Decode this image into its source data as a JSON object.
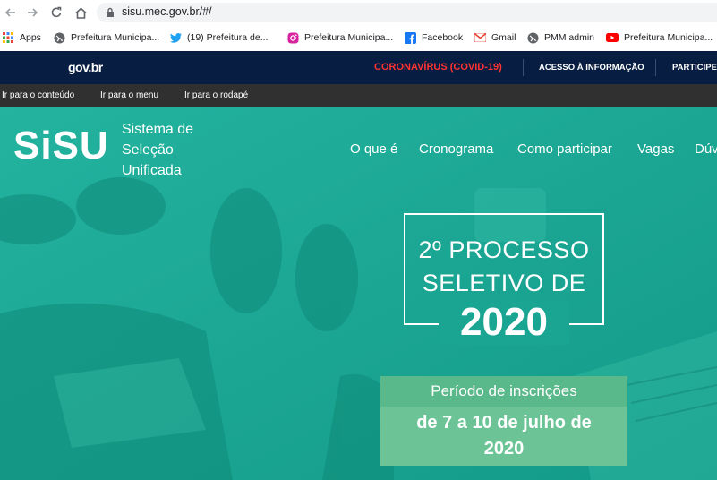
{
  "browser": {
    "url": "sisu.mec.gov.br/#/"
  },
  "bookmarks": [
    {
      "label": "Apps",
      "icon": "apps-grid-icon"
    },
    {
      "label": "Prefeitura Municipa...",
      "icon": "globe-icon"
    },
    {
      "label": "(19) Prefeitura de...",
      "icon": "twitter-icon"
    },
    {
      "label": "Prefeitura Municipa...",
      "icon": "instagram-icon"
    },
    {
      "label": "Facebook",
      "icon": "facebook-icon"
    },
    {
      "label": "Gmail",
      "icon": "gmail-icon"
    },
    {
      "label": "PMM admin",
      "icon": "globe-icon"
    },
    {
      "label": "Prefeitura Municipa...",
      "icon": "youtube-icon"
    }
  ],
  "gov_bar": {
    "logo": "gov.br",
    "covid": "CORONAVÍRUS (COVID-19)",
    "acesso": "ACESSO À INFORMAÇÃO",
    "participe": "PARTICIPE"
  },
  "skip_links": [
    "Ir para o conteúdo",
    "Ir para o menu",
    "Ir para o rodapé"
  ],
  "header": {
    "logo": "SiSU",
    "subtitle": [
      "Sistema de",
      "Seleção",
      "Unificada"
    ],
    "menu": [
      "O que é",
      "Cronograma",
      "Como participar",
      "Vagas",
      "Dúv"
    ]
  },
  "hero": {
    "line1": "2º PROCESSO",
    "line2": "SELETIVO DE",
    "year": "2020",
    "period_label": "Período de inscrições",
    "period_line1": "de 7 a 10 de julho de",
    "period_line2": "2020"
  },
  "colors": {
    "gov_bar": "#071d41",
    "covid_red": "#ff3333",
    "hero_teal": "#1aa592",
    "period_green": "#6cc496"
  }
}
